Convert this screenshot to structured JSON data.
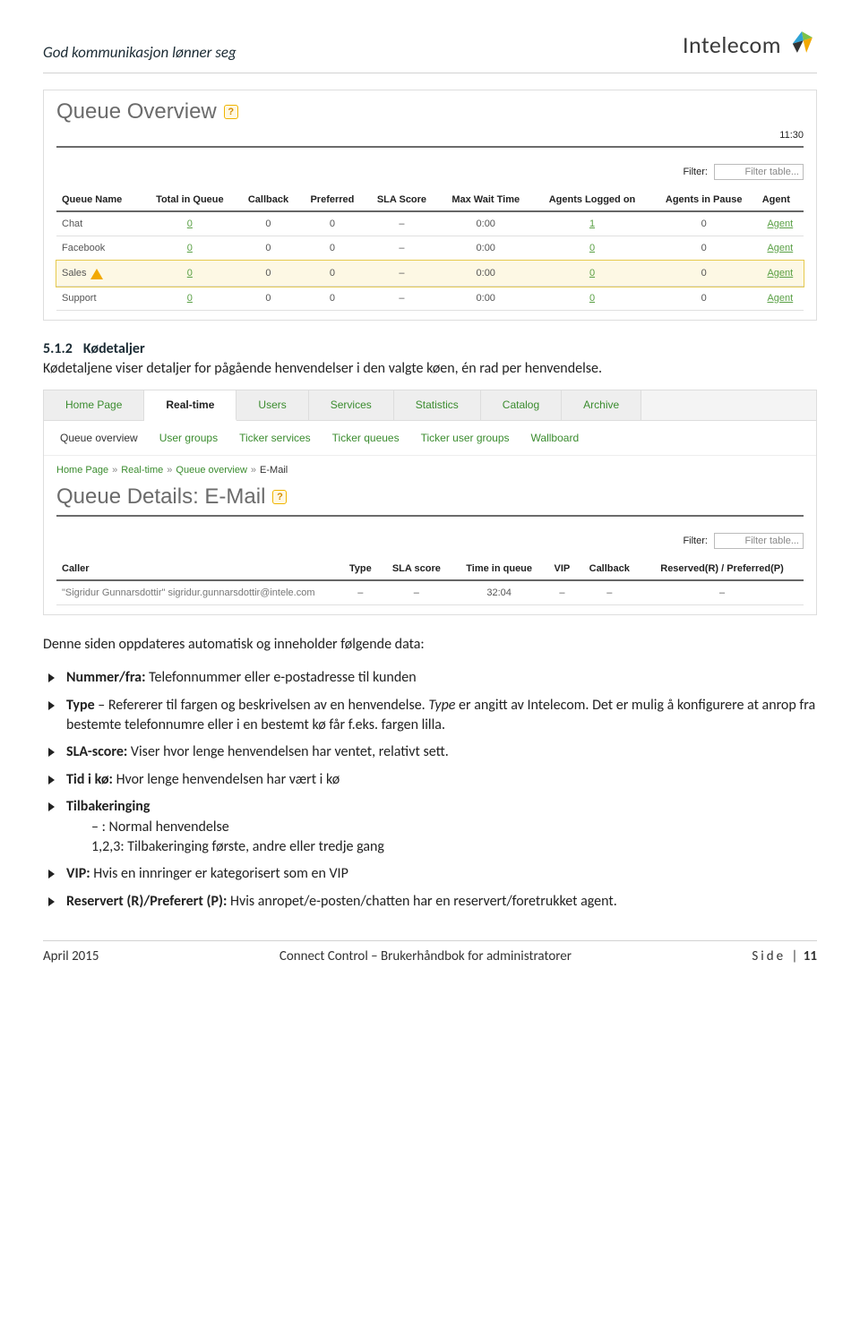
{
  "header": {
    "slogan": "God kommunikasjon lønner seg",
    "brand": "Intelecom"
  },
  "shot1": {
    "title": "Queue Overview",
    "clock": "11:30",
    "filter_label": "Filter:",
    "filter_placeholder": "Filter table...",
    "columns": [
      "Queue Name",
      "Total in Queue",
      "Callback",
      "Preferred",
      "SLA Score",
      "Max Wait Time",
      "Agents Logged on",
      "Agents in Pause",
      "Agent"
    ],
    "rows": [
      {
        "name": "Chat",
        "total": "0",
        "callback": "0",
        "preferred": "0",
        "sla": "–",
        "maxwait": "0:00",
        "logged": "1",
        "pause": "0",
        "agent": "Agent",
        "warn": false
      },
      {
        "name": "Facebook",
        "total": "0",
        "callback": "0",
        "preferred": "0",
        "sla": "–",
        "maxwait": "0:00",
        "logged": "0",
        "pause": "0",
        "agent": "Agent",
        "warn": false
      },
      {
        "name": "Sales",
        "total": "0",
        "callback": "0",
        "preferred": "0",
        "sla": "–",
        "maxwait": "0:00",
        "logged": "0",
        "pause": "0",
        "agent": "Agent",
        "warn": true
      },
      {
        "name": "Support",
        "total": "0",
        "callback": "0",
        "preferred": "0",
        "sla": "–",
        "maxwait": "0:00",
        "logged": "0",
        "pause": "0",
        "agent": "Agent",
        "warn": false
      }
    ]
  },
  "section": {
    "num": "5.1.2",
    "title": "Kødetaljer",
    "intro": "Kødetaljene viser detaljer for pågående henvendelser i den valgte køen, én rad per henvendelse."
  },
  "shot2": {
    "tabs": [
      "Home Page",
      "Real-time",
      "Users",
      "Services",
      "Statistics",
      "Catalog",
      "Archive"
    ],
    "active_tab": 1,
    "subtabs": [
      "Queue overview",
      "User groups",
      "Ticker services",
      "Ticker queues",
      "Ticker user groups",
      "Wallboard"
    ],
    "breadcrumb": [
      "Home Page",
      "Real-time",
      "Queue overview",
      "E-Mail"
    ],
    "title": "Queue Details: E-Mail",
    "filter_label": "Filter:",
    "filter_placeholder": "Filter table...",
    "columns": [
      "Caller",
      "Type",
      "SLA score",
      "Time in queue",
      "VIP",
      "Callback",
      "Reserved(R) / Preferred(P)"
    ],
    "row": {
      "caller": "\"Sigridur Gunnarsdottir\" sigridur.gunnarsdottir@intele.com",
      "type": "–",
      "sla": "–",
      "time": "32:04",
      "vip": "–",
      "callback": "–",
      "reserved": "–"
    }
  },
  "para_before_bullets": "Denne siden oppdateres automatisk og inneholder følgende data:",
  "bullets": [
    {
      "b": "Nummer/fra:",
      "t": " Telefonnummer eller e-postadresse til kunden"
    },
    {
      "b": "Type",
      "t": " – Refererer til fargen og beskrivelsen av en henvendelse. Type er angitt av Intelecom. Det er mulig å konfigurere at anrop fra bestemte telefonnumre eller i en bestemt kø får f.eks. fargen lilla.",
      "i": true
    },
    {
      "b": "SLA-score:",
      "t": " Viser hvor lenge henvendelsen har ventet, relativt sett."
    },
    {
      "b": "Tid i kø:",
      "t": " Hvor lenge henvendelsen har vært i kø"
    },
    {
      "b": "Tilbakeringing",
      "t": "",
      "sub": [
        "– : Normal henvendelse",
        "1,2,3: Tilbakeringing første, andre eller tredje gang"
      ]
    },
    {
      "b": "VIP:",
      "t": " Hvis en innringer er kategorisert som en VIP"
    },
    {
      "b": "Reservert (R)/Preferert (P):",
      "t": " Hvis anropet/e-posten/chatten har en reservert/foretrukket agent."
    }
  ],
  "footer": {
    "left": "April 2015",
    "center": "Connect Control – Brukerhåndbok for administratorer",
    "right_label": "Side",
    "right_sep": "|",
    "page": "11"
  }
}
